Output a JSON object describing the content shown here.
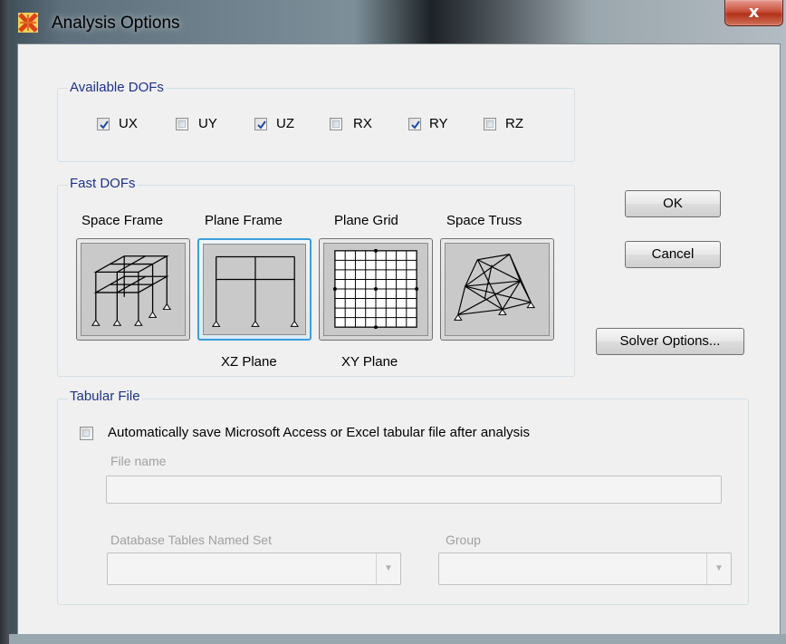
{
  "window": {
    "title": "Analysis Options",
    "close_symbol": "x",
    "app_icon": "sap2000-app-icon"
  },
  "available_dofs": {
    "title": "Available DOFs",
    "items": [
      {
        "label": "UX",
        "checked": true
      },
      {
        "label": "UY",
        "checked": false
      },
      {
        "label": "UZ",
        "checked": true
      },
      {
        "label": "RX",
        "checked": false
      },
      {
        "label": "RY",
        "checked": true
      },
      {
        "label": "RZ",
        "checked": false
      }
    ]
  },
  "fast_dofs": {
    "title": "Fast DOFs",
    "options": [
      {
        "label": "Space Frame",
        "sublabel": "",
        "icon": "space-frame-icon",
        "selected": false
      },
      {
        "label": "Plane Frame",
        "sublabel": "XZ Plane",
        "icon": "plane-frame-icon",
        "selected": true
      },
      {
        "label": "Plane Grid",
        "sublabel": "XY Plane",
        "icon": "plane-grid-icon",
        "selected": false
      },
      {
        "label": "Space Truss",
        "sublabel": "",
        "icon": "space-truss-icon",
        "selected": false
      }
    ]
  },
  "buttons": {
    "ok": "OK",
    "cancel": "Cancel",
    "solver_options": "Solver Options..."
  },
  "tabular_file": {
    "title": "Tabular File",
    "auto_save_label": "Automatically save Microsoft Access or Excel tabular file after analysis",
    "auto_save_checked": false,
    "file_name_label": "File name",
    "file_name_value": "",
    "named_set_label": "Database Tables Named Set",
    "named_set_value": "",
    "group_label": "Group",
    "group_value": ""
  },
  "colors": {
    "group_title": "#1e3287",
    "selected_border": "#3c9fd9",
    "close_button": "#c9503c",
    "dialog_bg": "#f0f0f0"
  }
}
